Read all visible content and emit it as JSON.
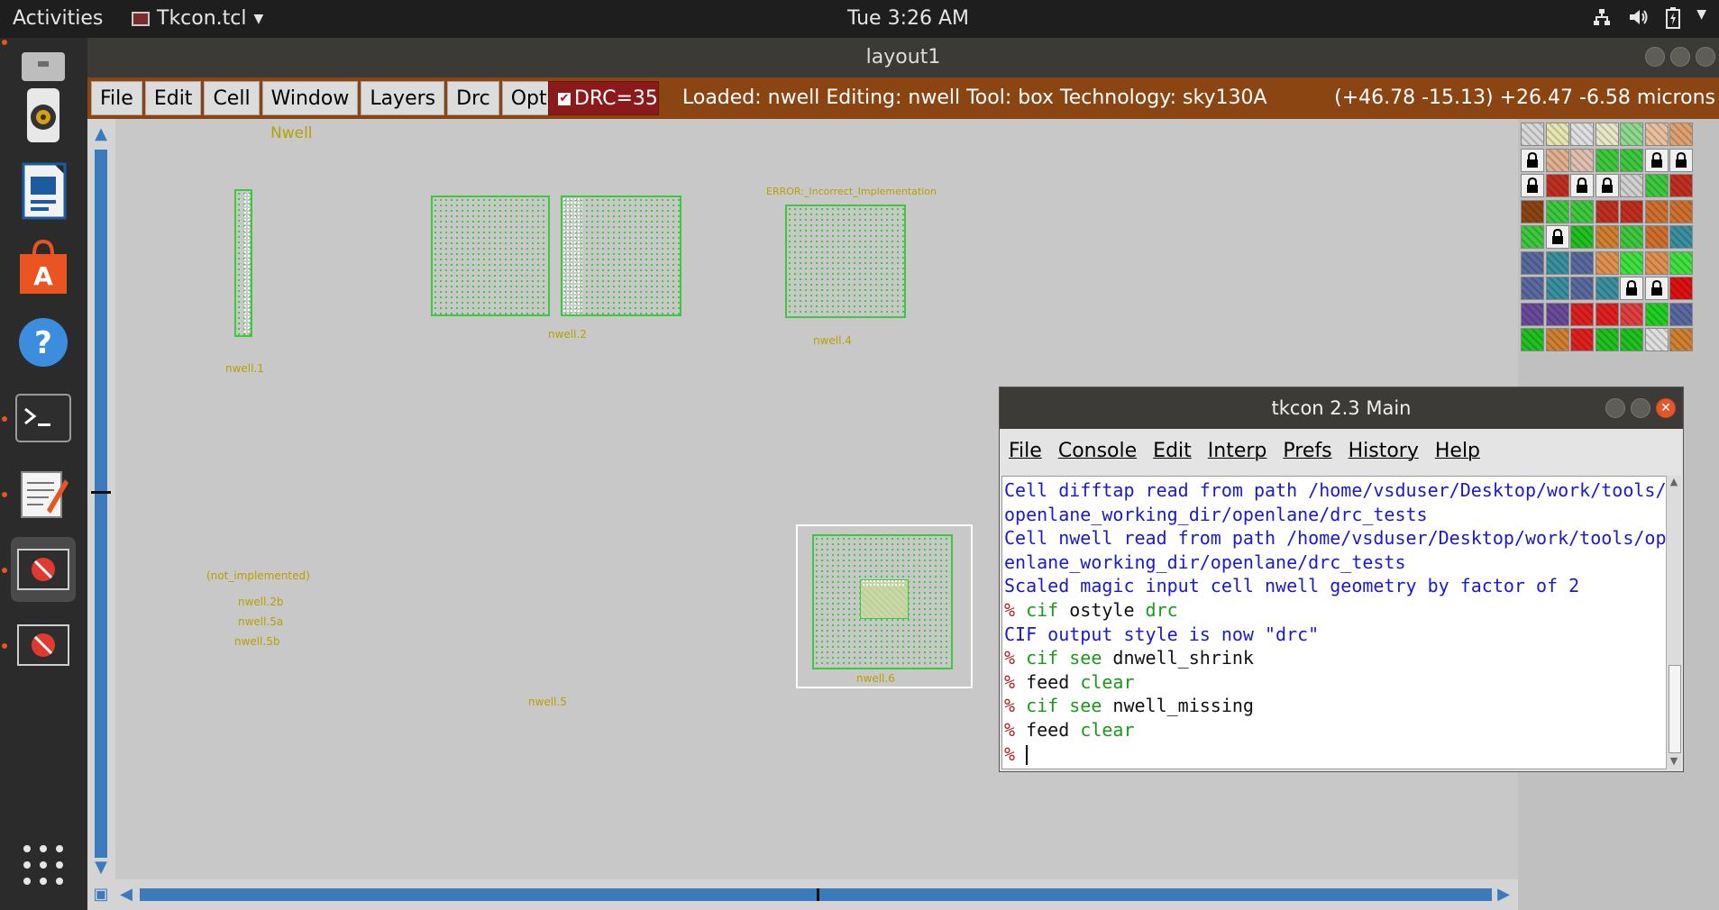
{
  "topbar": {
    "activities": "Activities",
    "app_name": "Tkcon.tcl",
    "clock": "Tue  3:26 AM"
  },
  "dock": {
    "items": [
      "Files",
      "Rhythmbox",
      "LibreOffice Impress",
      "Ubuntu Software",
      "Help",
      "Terminal",
      "Text Editor",
      "Application 1",
      "Application 2",
      "Show Applications"
    ]
  },
  "layout_window": {
    "title": "layout1"
  },
  "magic_menubar": {
    "menus": [
      "File",
      "Edit",
      "Cell",
      "Window",
      "Layers",
      "Drc",
      "Options"
    ],
    "drc_label": "DRC=35",
    "status": "Loaded: nwell Editing: nwell Tool: box  Technology: sky130A",
    "coords": "(+46.78 -15.13) +26.47 -6.58 microns"
  },
  "canvas": {
    "labels": {
      "nwell_top": "Nwell",
      "nwell_1": "nwell.1",
      "nwell_2": "nwell.2",
      "error_label": "ERROR:_Incorrect_Implementation",
      "nwell_4": "nwell.4",
      "not_implemented": "(not_implemented)",
      "nwell_2b": "nwell.2b",
      "nwell_5a": "nwell.5a",
      "nwell_5b": "nwell.5b",
      "nwell_5": "nwell.5",
      "nwell_6": "nwell.6"
    }
  },
  "tkcon": {
    "title": "tkcon 2.3 Main",
    "menus": [
      "File",
      "Console",
      "Edit",
      "Interp",
      "Prefs",
      "History",
      "Help"
    ],
    "output": {
      "line1": "Cell difftap read from path /home/vsduser/Desktop/work/tools/",
      "line2": "openlane_working_dir/openlane/drc_tests",
      "line3": "Cell nwell read from path /home/vsduser/Desktop/work/tools/op",
      "line4": "enlane_working_dir/openlane/drc_tests",
      "line5": "Scaled magic input cell nwell geometry by factor of 2",
      "cmd1_a": "cif",
      "cmd1_b": " ostyle ",
      "cmd1_c": "drc",
      "line6": "CIF output style is now \"drc\"",
      "cmd2_a": "cif see",
      "cmd2_b": " dnwell_shrink",
      "cmd3_a": "feed ",
      "cmd3_b": "clear",
      "cmd4_a": "cif see",
      "cmd4_b": " nwell_missing",
      "cmd5_a": "feed ",
      "cmd5_b": "clear",
      "prompt": "%"
    }
  },
  "colors": {
    "menubar_bg": "#8b4513",
    "drc_bg": "#8b1b1b",
    "canvas_bg": "#c8c8c8",
    "nwell_green": "#3ec83e",
    "label_yellow": "#b5a100",
    "scroll_blue": "#3b7bbd"
  }
}
